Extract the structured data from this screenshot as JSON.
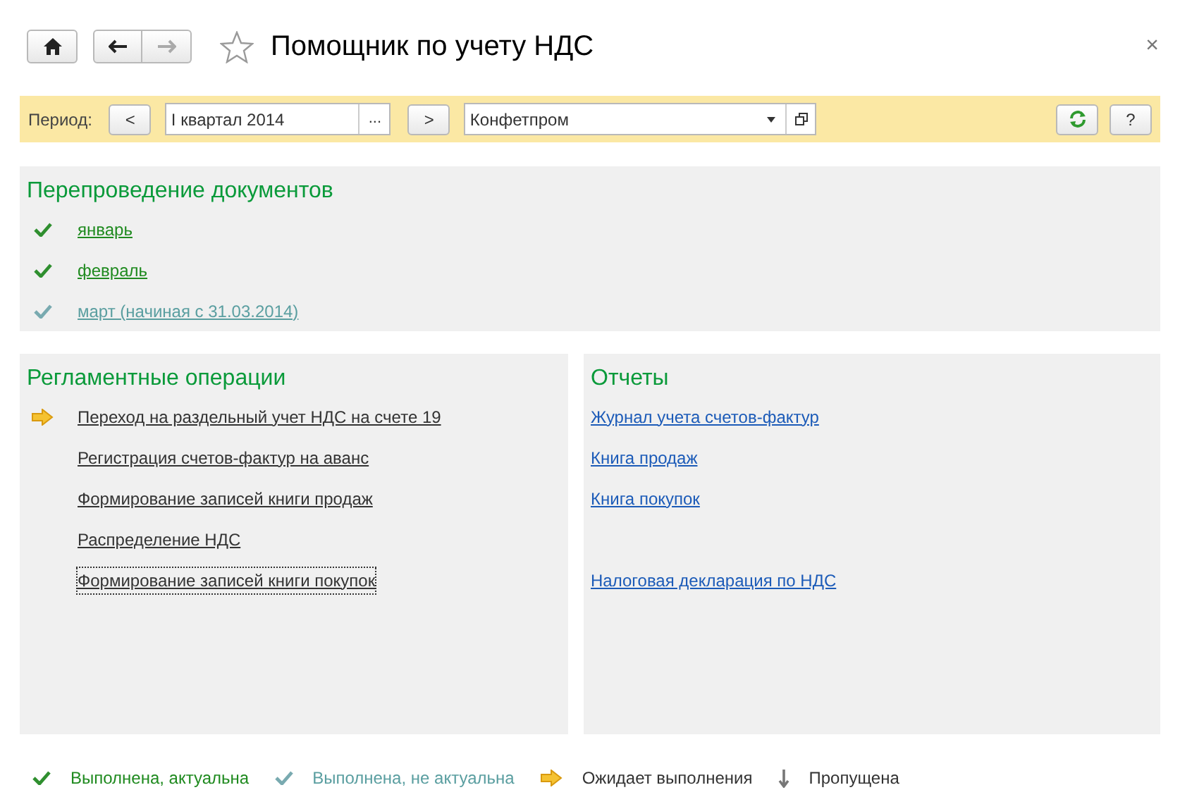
{
  "window": {
    "title": "Помощник по учету НДС",
    "favorite": false,
    "close": "×"
  },
  "toolbar": {
    "period_label": "Период:",
    "prev": "<",
    "period": "I квартал 2014",
    "choose": "...",
    "next": ">",
    "organization": "Конфетпром",
    "help": "?"
  },
  "reposting": {
    "title": "Перепроведение документов",
    "items": [
      {
        "label": "январь",
        "kind": "done"
      },
      {
        "label": "февраль",
        "kind": "done"
      },
      {
        "label": "март (начиная с 31.03.2014)",
        "kind": "stale"
      }
    ]
  },
  "operations": {
    "title": "Регламентные операции",
    "items": [
      {
        "label": "Переход на раздельный учет НДС на счете 19",
        "kind": "pending",
        "focused": false
      },
      {
        "label": "Регистрация счетов-фактур на аванс",
        "kind": "none",
        "focused": false
      },
      {
        "label": "Формирование записей книги продаж",
        "kind": "none",
        "focused": false
      },
      {
        "label": "Распределение НДС",
        "kind": "none",
        "focused": false
      },
      {
        "label": "Формирование записей книги покупок",
        "kind": "none",
        "focused": true
      }
    ]
  },
  "reports": {
    "title": "Отчеты",
    "groups": [
      [
        "Журнал учета счетов-фактур",
        "Книга продаж",
        "Книга покупок"
      ],
      [
        "Налоговая декларация по НДС"
      ]
    ]
  },
  "legend": [
    {
      "label": "Выполнена, актуальна",
      "kind": "done"
    },
    {
      "label": "Выполнена, не актуальна",
      "kind": "stale"
    },
    {
      "label": "Ожидает выполнения",
      "kind": "pending"
    },
    {
      "label": "Пропущена",
      "kind": "skipped"
    }
  ]
}
